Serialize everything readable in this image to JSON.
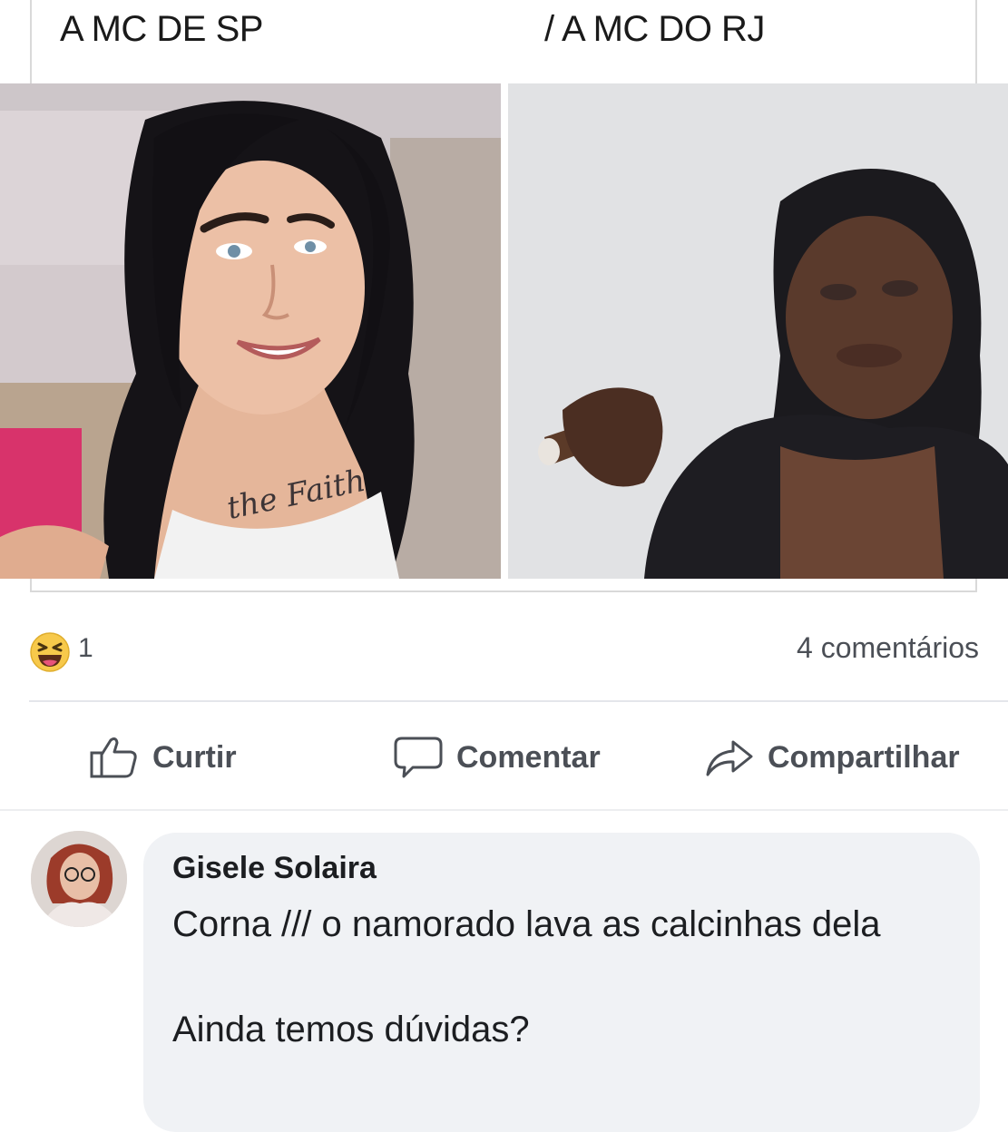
{
  "meme": {
    "caption_left": "A MC DE SP",
    "caption_right": "/ A MC DO RJ",
    "tattoo_text": "the Faith"
  },
  "post_stats": {
    "reaction_icon": "haha-reaction-icon",
    "reaction_count": "1",
    "comments_label": "4 comentários"
  },
  "actions": {
    "like_label": "Curtir",
    "comment_label": "Comentar",
    "share_label": "Compartilhar"
  },
  "comment": {
    "author": "Gisele Solaira",
    "line1": "Corna /// o namorado lava as calcinhas dela",
    "line2": "Ainda temos dúvidas?"
  },
  "colors": {
    "text_primary": "#1c1e21",
    "text_secondary": "#4b4f56",
    "bubble": "#f0f2f5",
    "divider": "#e4e6eb",
    "reaction_yellow": "#f7c94b"
  }
}
